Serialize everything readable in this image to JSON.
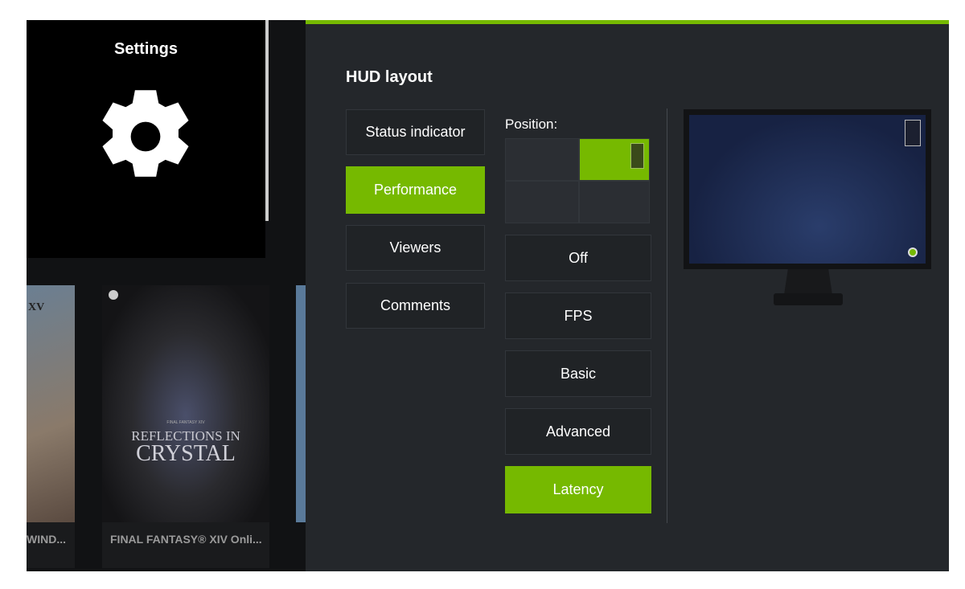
{
  "settings_tile": {
    "title": "Settings",
    "icon": "gear-icon"
  },
  "games": [
    {
      "title": "WIND...",
      "art_text": "XV"
    },
    {
      "title": "FINAL FANTASY® XIV Onli...",
      "art_text_small": "FINAL FANTASY XIV",
      "art_text_1": "REFLECTIONS IN",
      "art_text_2": "CRYSTAL"
    }
  ],
  "panel": {
    "accent": "#76b900",
    "title": "HUD layout",
    "categories": [
      {
        "label": "Status indicator",
        "selected": false
      },
      {
        "label": "Performance",
        "selected": true
      },
      {
        "label": "Viewers",
        "selected": false
      },
      {
        "label": "Comments",
        "selected": false
      }
    ],
    "position_label": "Position:",
    "position_selected": "top-right",
    "modes": [
      {
        "label": "Off",
        "selected": false
      },
      {
        "label": "FPS",
        "selected": false
      },
      {
        "label": "Basic",
        "selected": false
      },
      {
        "label": "Advanced",
        "selected": false
      },
      {
        "label": "Latency",
        "selected": true
      }
    ]
  }
}
